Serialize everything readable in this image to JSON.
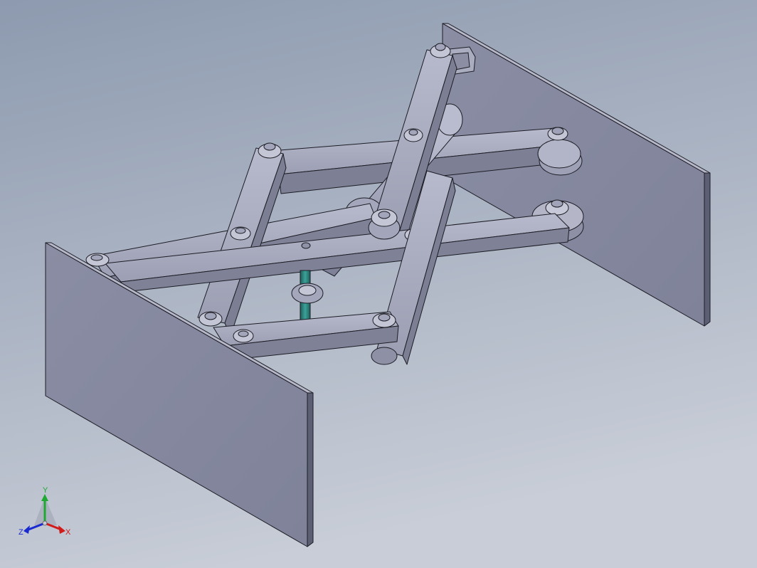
{
  "viewport": {
    "background_top": "#8e9bb0",
    "background_bottom": "#c7ccd6"
  },
  "model": {
    "description_name": "scissor-lift-clamp-assembly",
    "part_color": "#a0a2b8",
    "part_light": "#bfc1d3",
    "part_dark": "#6f7187",
    "edge_color": "#1c1c24",
    "cylinder_rod_color": "#2e7d76"
  },
  "triad": {
    "x_label": "X",
    "y_label": "Y",
    "z_label": "Z",
    "x_color": "#d11a1a",
    "y_color": "#1fa832",
    "z_color": "#1a2ad1"
  }
}
